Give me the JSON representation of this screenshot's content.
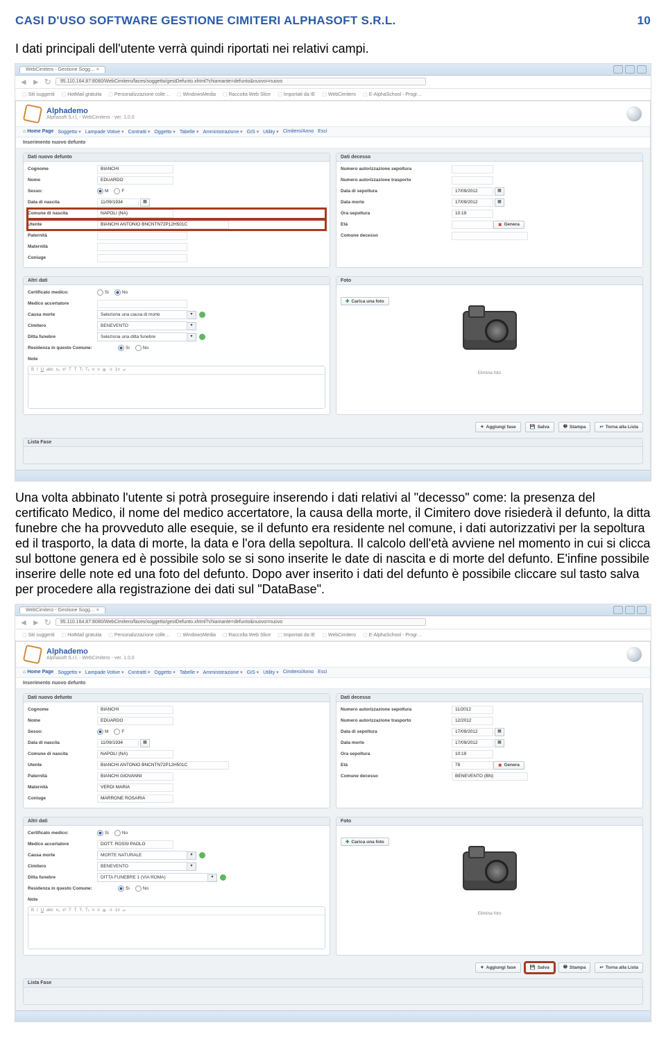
{
  "doc": {
    "header_left": "CASI D'USO SOFTWARE GESTIONE CIMITERI ALPHASOFT S.R.L.",
    "header_right": "10",
    "lead": "I dati principali dell'utente verrà quindi riportati nei relativi campi.",
    "body": "Una volta abbinato l'utente si potrà proseguire inserendo i dati relativi al \"decesso\" come: la presenza del certificato Medico, il nome del medico accertatore, la causa della morte, il Cimitero dove risiederà il defunto, la ditta funebre che ha provveduto alle esequie, se il defunto era residente nel comune, i dati autorizzativi per la sepoltura ed il trasporto, la data di morte, la data e l'ora della sepoltura. Il calcolo dell'età avviene nel momento in cui si clicca sul bottone genera ed è possibile solo se si sono inserite le date di nascita e di morte del defunto. E'infine possibile inserire delle note ed una foto del defunto. Dopo aver inserito i dati del defunto è possibile cliccare sul tasto salva per procedere alla registrazione dei dati sul \"DataBase\"."
  },
  "browser": {
    "tab": "WebCimitero - Gestione Sogg… ×",
    "url": "95.110.164.87:8080/WebCimitero/faces/soggetto/gestDefunto.xhtml?chiamante=defunto&nuovo=nuovo",
    "bookmarks": [
      "Siti suggeriti",
      "HotMail gratuita",
      "Personalizzazione colle…",
      "WindowsMedia",
      "Raccolta Web Slice",
      "Importati da IE",
      "WebCimitero",
      "E-AlphaSchool - Progr…"
    ]
  },
  "app": {
    "brand_title": "Alphademo",
    "brand_sub": "Alphasoft S.r.l. - WebCimitero - ver. 1.0.0",
    "menu": [
      "Home Page",
      "Soggetto",
      "Lampade Votive",
      "Contratti",
      "Oggetto",
      "Tabelle",
      "Amministrazione",
      "GIS",
      "Utility",
      "Cimitero/Anno",
      "Esci"
    ],
    "crumb": "Inserimento nuovo defunto",
    "panel_left": "Dati nuovo defunto",
    "panel_right": "Dati decesso",
    "panel_altri": "Altri dati",
    "panel_foto": "Foto",
    "lista": "Lista Fase",
    "labels": {
      "cognome": "Cognome",
      "nome": "Nome",
      "sesso": "Sesso:",
      "dob": "Data di nascita",
      "comune": "Comune di nascita",
      "utente": "Utente",
      "paternita": "Paternità",
      "maternita": "Maternità",
      "coniuge": "Coniuge",
      "naut_sep": "Numero autorizzazione sepoltura",
      "naut_tra": "Numero autorizzazione trasporto",
      "data_sep": "Data di sepoltura",
      "data_morte": "Data morte",
      "ora_sep": "Ora sepoltura",
      "eta": "Età",
      "comune_dec": "Comune decesso",
      "cert": "Certificato medico:",
      "medico": "Medico accertatore",
      "causa": "Causa morte",
      "cimitero": "Cimitero",
      "ditta": "Ditta funebre",
      "residenza": "Residenza in questo Comune:",
      "note": "Note"
    },
    "radio": {
      "m": "M",
      "f": "F",
      "si": "Si",
      "no": "No"
    },
    "btn": {
      "genera": "Genera",
      "carica": "Carica una foto",
      "aggiungi": "Aggiungi fase",
      "salva": "Salva",
      "stampa": "Stampa",
      "torna": "Torna alla Lista",
      "elimina": "Elimina foto"
    },
    "ph": {
      "causa": "Seleziona una causa di morte",
      "ditta": "Seleziona una ditta funebre"
    }
  },
  "s1": {
    "cognome": "BIANCHI",
    "nome": "EDUARDO",
    "dob": "11/09/1934",
    "comune": "NAPOLI (NA)",
    "utente": "BIANCHI ANTONIO BNCNTN72P12H501C",
    "paternita": "",
    "maternita": "",
    "coniuge": "",
    "naut_sep": "",
    "naut_tra": "",
    "data_sep": "17/09/2012",
    "data_morte": "17/09/2012",
    "ora_sep": "10:19",
    "eta": "",
    "comune_dec": "",
    "medico": "",
    "causa": "",
    "cimitero": "BENEVENTO",
    "ditta": ""
  },
  "s2": {
    "cognome": "BIANCHI",
    "nome": "EDUARDO",
    "dob": "11/09/1934",
    "comune": "NAPOLI (NA)",
    "utente": "BIANCHI ANTONIO BNCNTN72P12H501C",
    "paternita": "BIANCHI GIOVANNI",
    "maternita": "VERDI MARIA",
    "coniuge": "MARRONE ROSARIA",
    "naut_sep": "11/2012",
    "naut_tra": "12/2012",
    "data_sep": "17/09/2012",
    "data_morte": "17/09/2012",
    "ora_sep": "10:19",
    "eta": "78",
    "comune_dec": "BENEVENTO (BN)",
    "medico": "DOTT. ROSSI PAOLO",
    "causa": "MORTE NATURALE",
    "cimitero": "BENEVENTO",
    "ditta": "DITTA FUNEBRE 1 (VIA ROMA)"
  }
}
